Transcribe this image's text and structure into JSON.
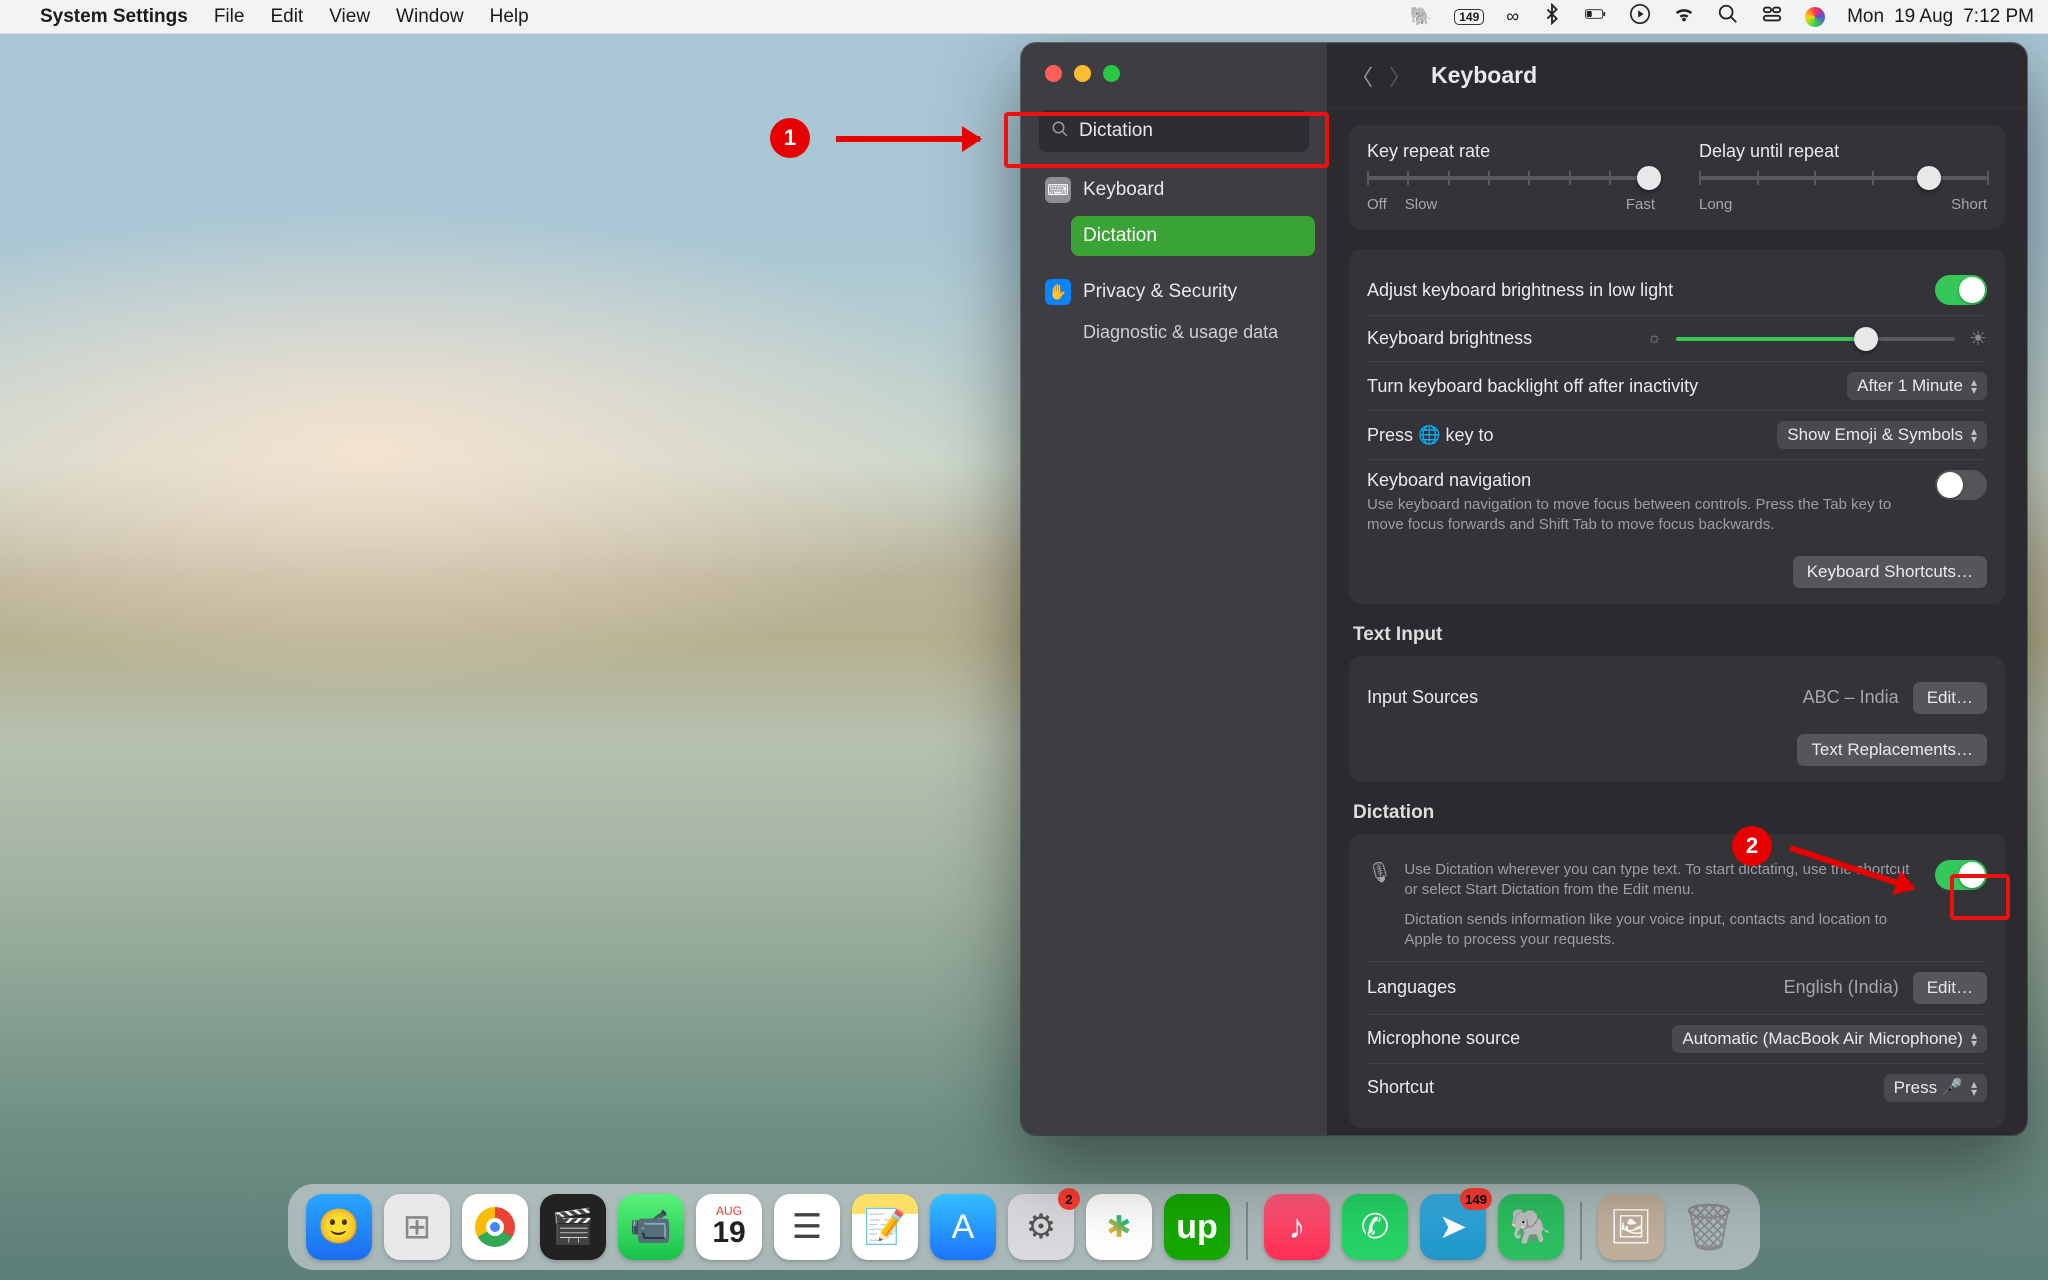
{
  "menubar": {
    "app": "System Settings",
    "items": [
      "File",
      "Edit",
      "View",
      "Window",
      "Help"
    ],
    "clock": {
      "day": "Mon",
      "date": "19 Aug",
      "time": "7:12 PM"
    },
    "badge_small": "149"
  },
  "sidebar": {
    "search_value": "Dictation",
    "items": [
      {
        "icon_bg": "#8e8e93",
        "icon": "⌨︎",
        "label": "Keyboard"
      },
      {
        "icon_bg": "transparent",
        "icon": "",
        "label": "Dictation",
        "active": true
      },
      {
        "icon_bg": "#0a84ff",
        "icon": "✋",
        "label": "Privacy & Security"
      }
    ],
    "subitem": "Diagnostic & usage data"
  },
  "settings": {
    "title": "Keyboard",
    "key_repeat_label": "Key repeat rate",
    "key_repeat_left": "Off",
    "key_repeat_left2": "Slow",
    "key_repeat_right": "Fast",
    "delay_label": "Delay until repeat",
    "delay_left": "Long",
    "delay_right": "Short",
    "adjust_brightness": "Adjust keyboard brightness in low light",
    "kbd_brightness": "Keyboard brightness",
    "backlight_off": "Turn keyboard backlight off after inactivity",
    "backlight_value": "After 1 Minute",
    "globe_label_pre": "Press",
    "globe_label_post": "key to",
    "globe_value": "Show Emoji & Symbols",
    "kbd_nav": "Keyboard navigation",
    "kbd_nav_desc": "Use keyboard navigation to move focus between controls. Press the Tab key to move focus forwards and Shift Tab to move focus backwards.",
    "kbd_shortcuts_btn": "Keyboard Shortcuts…",
    "text_input_h": "Text Input",
    "input_sources": "Input Sources",
    "input_sources_value": "ABC – India",
    "edit_btn": "Edit…",
    "text_replace_btn": "Text Replacements…",
    "dictation_h": "Dictation",
    "dictation_desc1": "Use Dictation wherever you can type text. To start dictating, use the shortcut or select Start Dictation from the Edit menu.",
    "dictation_desc2": "Dictation sends information like your voice input, contacts and location to Apple to process your requests.",
    "languages": "Languages",
    "languages_value": "English (India)",
    "mic_source": "Microphone source",
    "mic_value": "Automatic (MacBook Air Microphone)",
    "shortcut": "Shortcut",
    "shortcut_value": "Press 🎤"
  },
  "annotations": {
    "one": "1",
    "two": "2"
  },
  "dock": {
    "cal_month": "AUG",
    "cal_day": "19",
    "badge_settings": "2",
    "badge_telegram": "149"
  }
}
